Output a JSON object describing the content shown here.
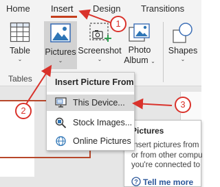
{
  "ribbon_tabs": {
    "home": "Home",
    "insert": "Insert",
    "design": "Design",
    "transitions": "Transitions"
  },
  "ribbon": {
    "table": "Table",
    "pictures": "Pictures",
    "screenshot": "Screenshot",
    "photo_album_line1": "Photo",
    "photo_album_line2": "Album",
    "shapes": "Shapes",
    "tables_group": "Tables",
    "caret": "⌄"
  },
  "menu": {
    "header": "Insert Picture From",
    "items": [
      {
        "label": "This Device...",
        "icon": "device-icon"
      },
      {
        "label": "Stock Images...",
        "icon": "stock-images-icon"
      },
      {
        "label": "Online Pictures",
        "icon": "online-pictures-icon"
      }
    ]
  },
  "tooltip": {
    "title": "Pictures",
    "line1": "Insert pictures from",
    "line2": "or from other compu",
    "line3": "you're connected to",
    "link": "Tell me more"
  },
  "callouts": {
    "one": "1",
    "two": "2",
    "three": "3"
  },
  "colors": {
    "accent": "#c43e1c",
    "annotation": "#d9322b"
  }
}
